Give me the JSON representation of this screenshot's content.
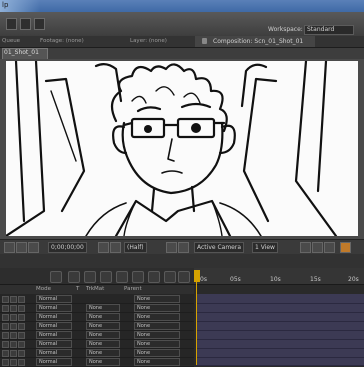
{
  "app": {
    "title_fragment": "lp"
  },
  "workspace": {
    "label": "Workspace:",
    "value": "Standard"
  },
  "tabs": {
    "queue": "Queue",
    "footage": "Footage: (none)",
    "layer": "Layer: (none)",
    "composition": "Composition: Scn_01_Shot_01"
  },
  "subtab": {
    "label": "01_Shot_01"
  },
  "viewer": {
    "timecode": "0;00;00;00",
    "resolution": "(Half)",
    "camera": "Active Camera",
    "views": "1 View"
  },
  "timeline": {
    "ruler_ticks": [
      "0s",
      "05s",
      "10s",
      "15s",
      "20s"
    ],
    "columns": {
      "mode": "Mode",
      "t": "T",
      "trkmat": "TrkMat",
      "parent": "Parent"
    },
    "rows": [
      {
        "mode": "Normal",
        "trkmat": "",
        "parent": "None"
      },
      {
        "mode": "Normal",
        "trkmat": "None",
        "parent": "None"
      },
      {
        "mode": "Normal",
        "trkmat": "None",
        "parent": "None"
      },
      {
        "mode": "Normal",
        "trkmat": "None",
        "parent": "None"
      },
      {
        "mode": "Normal",
        "trkmat": "None",
        "parent": "None"
      },
      {
        "mode": "Normal",
        "trkmat": "None",
        "parent": "None"
      },
      {
        "mode": "Normal",
        "trkmat": "None",
        "parent": "None"
      },
      {
        "mode": "Normal",
        "trkmat": "None",
        "parent": "None"
      }
    ]
  },
  "colors": {
    "accent": "#d6a300",
    "layer_bar": "#3c3a54"
  }
}
